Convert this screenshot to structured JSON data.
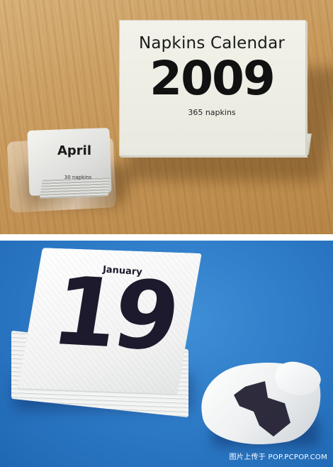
{
  "top_photo": {
    "box": {
      "title": "Napkins Calendar",
      "year": "2009",
      "count": "365 napkins"
    },
    "pack": {
      "month": "April",
      "count": "30 napkins"
    }
  },
  "bottom_photo": {
    "napkin": {
      "month": "January",
      "day": "19"
    },
    "watermark": "图片上传于 POP.PCPOP.COM"
  }
}
